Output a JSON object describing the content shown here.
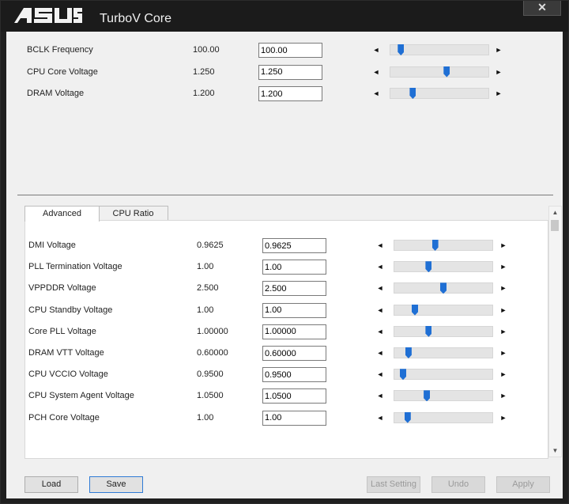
{
  "window": {
    "brand": "ASUS",
    "title": "TurboV Core",
    "close_symbol": "✕"
  },
  "top_settings": [
    {
      "label": "BCLK Frequency",
      "current": "100.00",
      "input": "100.00",
      "level": 0.08
    },
    {
      "label": "CPU Core Voltage",
      "current": "1.250",
      "input": "1.250",
      "level": 0.58
    },
    {
      "label": "DRAM Voltage",
      "current": "1.200",
      "input": "1.200",
      "level": 0.21
    }
  ],
  "tabs": [
    {
      "label": "Advanced",
      "active": true
    },
    {
      "label": "CPU Ratio",
      "active": false
    }
  ],
  "advanced_settings": [
    {
      "label": "DMI Voltage",
      "current": "0.9625",
      "input": "0.9625",
      "level": 0.41
    },
    {
      "label": "PLL Termination Voltage",
      "current": "1.00",
      "input": "1.00",
      "level": 0.34
    },
    {
      "label": "VPPDDR Voltage",
      "current": "2.500",
      "input": "2.500",
      "level": 0.5
    },
    {
      "label": "CPU Standby Voltage",
      "current": "1.00",
      "input": "1.00",
      "level": 0.19
    },
    {
      "label": "Core PLL Voltage",
      "current": "1.00000",
      "input": "1.00000",
      "level": 0.34
    },
    {
      "label": "DRAM VTT Voltage",
      "current": "0.60000",
      "input": "0.60000",
      "level": 0.12
    },
    {
      "label": "CPU VCCIO Voltage",
      "current": "0.9500",
      "input": "0.9500",
      "level": 0.06
    },
    {
      "label": "CPU System Agent Voltage",
      "current": "1.0500",
      "input": "1.0500",
      "level": 0.32
    },
    {
      "label": "PCH Core Voltage",
      "current": "1.00",
      "input": "1.00",
      "level": 0.11
    }
  ],
  "arrows": {
    "left": "◄",
    "right": "►",
    "up": "▲",
    "down": "▼"
  },
  "buttons": {
    "load": "Load",
    "save": "Save",
    "last_setting": "Last Setting",
    "undo": "Undo",
    "apply": "Apply"
  },
  "colors": {
    "accent": "#1f6fd4",
    "titlebar": "#1b1b1b",
    "panel": "#f0f0f0"
  }
}
